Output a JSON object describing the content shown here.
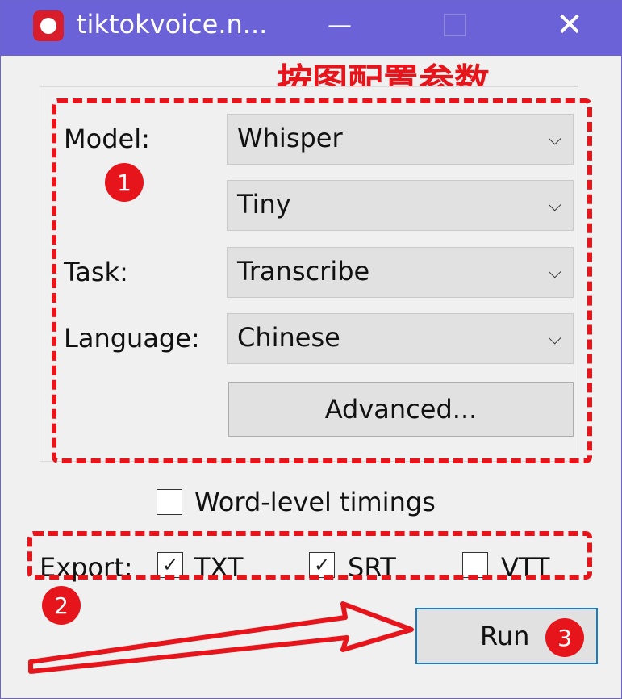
{
  "window": {
    "title": "tiktokvoice.n...",
    "min_icon": "—",
    "close_icon": "✕"
  },
  "annotation_text": "按图配置参数",
  "labels": {
    "model": "Model:",
    "task": "Task:",
    "language": "Language:"
  },
  "combos": {
    "model": "Whisper",
    "size": "Tiny",
    "task": "Transcribe",
    "language": "Chinese"
  },
  "chevron": "⌵",
  "buttons": {
    "advanced": "Advanced...",
    "run": "Run"
  },
  "word_level": {
    "label": "Word-level timings",
    "checked": false
  },
  "export": {
    "label": "Export:",
    "txt": {
      "label": "TXT",
      "checked": true,
      "mark": "✓"
    },
    "srt": {
      "label": "SRT",
      "checked": true,
      "mark": "✓"
    },
    "vtt": {
      "label": "VTT",
      "checked": false
    }
  },
  "badges": {
    "one": "1",
    "two": "2",
    "three": "3"
  },
  "colors": {
    "titlebar": "#6a62d6",
    "annotation": "#e6141b",
    "run_border": "#1a7cc8"
  }
}
